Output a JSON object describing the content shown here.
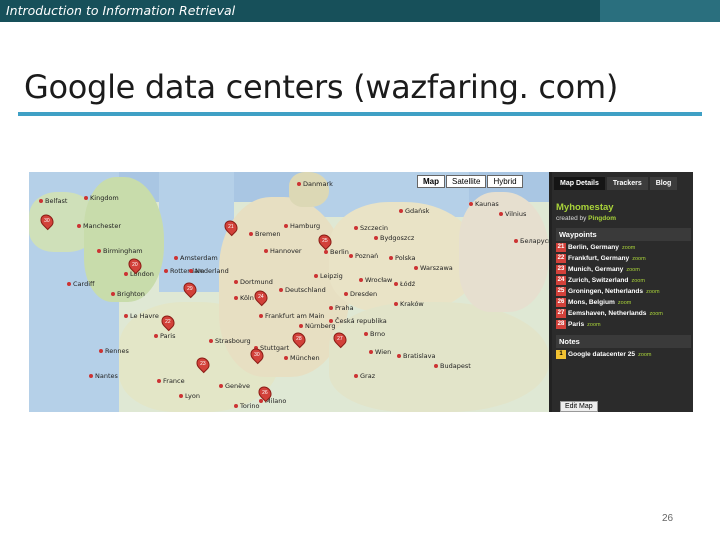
{
  "header": {
    "course_title": "Introduction to Information Retrieval"
  },
  "slide": {
    "title": "Google data centers (wazfaring. com)",
    "page_number": "26"
  },
  "map": {
    "map_types": [
      "Map",
      "Satellite",
      "Hybrid"
    ],
    "cities": [
      "Belfast",
      "Kingdom",
      "Manchester",
      "Birmingham",
      "Cardiff",
      "London",
      "Brighton",
      "Le Havre",
      "Rennes",
      "Nantes",
      "France",
      "Paris",
      "Bremen",
      "Hamburg",
      "Hannover",
      "Amsterdam",
      "Rotterdam",
      "Nederland",
      "Dortmund",
      "Köln",
      "Frankfurt am Main",
      "Deutschland",
      "Berlin",
      "Leipzig",
      "Dresden",
      "Nürnberg",
      "Stuttgart",
      "München",
      "Strasbourg",
      "Szczecin",
      "Gdańsk",
      "Bydgoszcz",
      "Poznań",
      "Polska",
      "Warszawa",
      "Łódź",
      "Wrocław",
      "Kraków",
      "Praha",
      "Česká republika",
      "Brno",
      "Wien",
      "Graz",
      "Bratislava",
      "Budapest",
      "Danmark",
      "Kaunas",
      "Vilnius",
      "Беларусь",
      "Lyon",
      "Genève",
      "Milano",
      "Torino"
    ],
    "markers": [
      "30",
      "20",
      "29",
      "22",
      "21",
      "25",
      "24",
      "28",
      "27",
      "30",
      "26",
      "23"
    ]
  },
  "panel": {
    "tabs": [
      "Map Details",
      "Trackers",
      "Blog"
    ],
    "title": "Myhomestay",
    "created_by_label": "created by",
    "created_by": "Pingdom",
    "waypoints_label": "Waypoints",
    "waypoints": [
      {
        "num": "21",
        "name": "Berlin, Germany",
        "zoom": "zoom"
      },
      {
        "num": "22",
        "name": "Frankfurt, Germany",
        "zoom": "zoom"
      },
      {
        "num": "23",
        "name": "Munich, Germany",
        "zoom": "zoom"
      },
      {
        "num": "24",
        "name": "Zurich, Switzerland",
        "zoom": "zoom"
      },
      {
        "num": "25",
        "name": "Groningen, Netherlands",
        "zoom": "zoom"
      },
      {
        "num": "26",
        "name": "Mons, Belgium",
        "zoom": "zoom"
      },
      {
        "num": "27",
        "name": "Eemshaven, Netherlands",
        "zoom": "zoom"
      },
      {
        "num": "28",
        "name": "Paris",
        "zoom": "zoom"
      }
    ],
    "notes_label": "Notes",
    "note": {
      "num": "1",
      "name": "Google datacenter 25",
      "zoom": "zoom"
    },
    "edit_map": "Edit Map"
  }
}
